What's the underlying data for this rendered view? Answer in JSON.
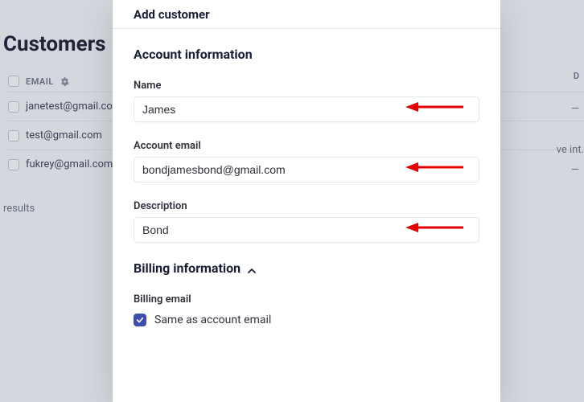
{
  "background": {
    "page_title": "Customers",
    "email_header": "EMAIL",
    "abbrev_d": "D",
    "rows": [
      "janetest@gmail.com",
      "test@gmail.com",
      "fukrey@gmail.com"
    ],
    "right_text": "ve int.",
    "dash1": "—",
    "dash2": "—",
    "results": "results"
  },
  "modal": {
    "title": "Add customer",
    "section_account": "Account information",
    "name_label": "Name",
    "name_value": "James",
    "email_label": "Account email",
    "email_value": "bondjamesbond@gmail.com",
    "desc_label": "Description",
    "desc_value": "Bond",
    "section_billing": "Billing information",
    "billing_email_label": "Billing email",
    "same_as_label": "Same as account email",
    "same_as_checked": true
  }
}
